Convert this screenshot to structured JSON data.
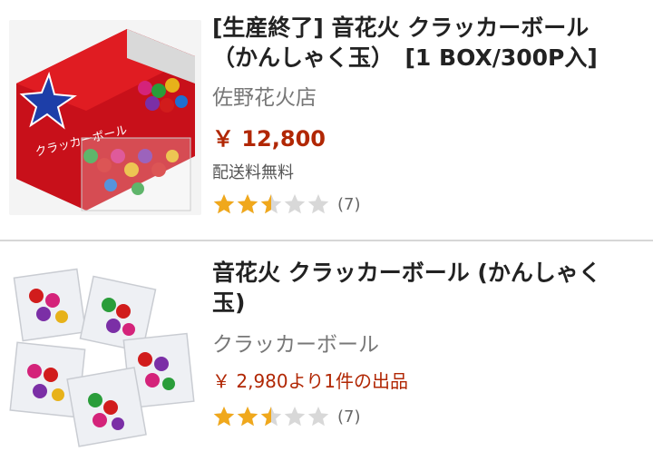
{
  "colors": {
    "price": "#b12704",
    "star_filled": "#f0a81c",
    "star_empty": "#d8d8d8"
  },
  "items": [
    {
      "title_line1": "[生産終了] 音花火 クラッカーボール",
      "title_line2": "（かんしゃく玉）　[1 BOX/300P入]",
      "seller": "佐野花火店",
      "price": "￥ 12,800",
      "shipping": "配送料無料",
      "rating": 2.5,
      "review_count": "(7)",
      "image": "box-of-cracker-balls"
    },
    {
      "title_line1": "音花火 クラッカーボール (かんしゃく",
      "title_line2": "玉)",
      "seller": "クラッカーボール",
      "price": "￥ 2,980より1件の出品",
      "rating": 2.5,
      "review_count": "(7)",
      "image": "bags-of-cracker-balls"
    }
  ]
}
